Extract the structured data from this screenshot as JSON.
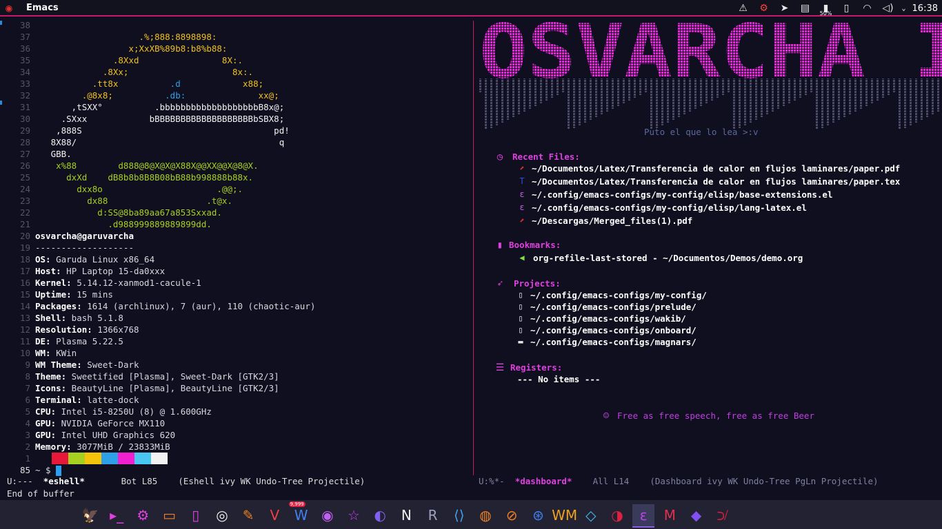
{
  "window": {
    "title": "Emacs"
  },
  "tray": {
    "icons": [
      "alert-icon",
      "network-monitor-icon",
      "send-icon",
      "clipboard-icon",
      "battery-icon",
      "phone-icon",
      "wifi-icon",
      "volume-icon"
    ],
    "battery_label": "50%",
    "clock": "16:38"
  },
  "eshell": {
    "art": [
      {
        "n": "38",
        "t": ""
      },
      {
        "n": "37",
        "segs": [
          [
            "y",
            "                    .%;888:8898898:"
          ]
        ]
      },
      {
        "n": "36",
        "segs": [
          [
            "y",
            "                  x;XxXB%89b8:b8%b88:"
          ]
        ]
      },
      {
        "n": "35",
        "segs": [
          [
            "y",
            "               .8Xxd                8X:."
          ]
        ]
      },
      {
        "n": "34",
        "segs": [
          [
            "y",
            "             .8Xx;                    8x:."
          ]
        ]
      },
      {
        "n": "33",
        "segs": [
          [
            "y",
            "           .tt8x          "
          ],
          [
            "b",
            ".d"
          ],
          [
            "y",
            "            x88;"
          ]
        ]
      },
      {
        "n": "32",
        "segs": [
          [
            "y",
            "         .@8x8;          "
          ],
          [
            "b",
            ".db:"
          ],
          [
            "y",
            "              xx@;"
          ]
        ]
      },
      {
        "n": "31",
        "segs": [
          [
            "w",
            "       ,tSXX°          .bbbbbbbbbbbbbbbbbbbB8x@;"
          ]
        ]
      },
      {
        "n": "30",
        "segs": [
          [
            "w",
            "     .SXxx            bBBBBBBBBBBBBBBBBBBBbSBX8;"
          ]
        ]
      },
      {
        "n": "29",
        "segs": [
          [
            "w",
            "    ,888S                                     pd!"
          ]
        ]
      },
      {
        "n": "28",
        "segs": [
          [
            "w",
            "   8X88/                                       q"
          ]
        ]
      },
      {
        "n": "27",
        "segs": [
          [
            "w",
            "   GBB."
          ]
        ]
      },
      {
        "n": "26",
        "segs": [
          [
            "g",
            "    x%88        d888@8@X@X@X88X@@XX@@X@8@X."
          ]
        ]
      },
      {
        "n": "25",
        "segs": [
          [
            "g",
            "      dxXd    dB8b8b8B8B08bB88b998888b88x."
          ]
        ]
      },
      {
        "n": "24",
        "segs": [
          [
            "g",
            "        dxx8o                      .@@;."
          ]
        ]
      },
      {
        "n": "23",
        "segs": [
          [
            "g",
            "          dx88                   .t@x."
          ]
        ]
      },
      {
        "n": "22",
        "segs": [
          [
            "g",
            "            d:SS@8ba89aa67a853Sxxad."
          ]
        ]
      },
      {
        "n": "21",
        "segs": [
          [
            "g",
            "              .d988999889889899dd."
          ]
        ]
      }
    ],
    "host_line": {
      "n": "20",
      "text": "osvarcha@garuvarcha"
    },
    "sep_line": {
      "n": "19",
      "text": "-------------------"
    },
    "info": [
      {
        "n": "18",
        "key": "OS",
        "val": " Garuda Linux x86_64"
      },
      {
        "n": "17",
        "key": "Host",
        "val": " HP Laptop 15-da0xxx"
      },
      {
        "n": "16",
        "key": "Kernel",
        "val": " 5.14.12-xanmod1-cacule-1"
      },
      {
        "n": "15",
        "key": "Uptime",
        "val": " 15 mins"
      },
      {
        "n": "14",
        "key": "Packages",
        "val": " 1614 (archlinux), 7 (aur), 110 (chaotic-aur)"
      },
      {
        "n": "13",
        "key": "Shell",
        "val": " bash 5.1.8"
      },
      {
        "n": "12",
        "key": "Resolution",
        "val": " 1366x768"
      },
      {
        "n": "11",
        "key": "DE",
        "val": " Plasma 5.22.5"
      },
      {
        "n": "10",
        "key": "WM",
        "val": " KWin"
      },
      {
        "n": "9",
        "key": "WM Theme",
        "val": " Sweet-Dark"
      },
      {
        "n": "8",
        "key": "Theme",
        "val": " Sweetified [Plasma], Sweet-Dark [GTK2/3]"
      },
      {
        "n": "7",
        "key": "Icons",
        "val": " BeautyLine [Plasma], BeautyLine [GTK2/3]"
      },
      {
        "n": "6",
        "key": "Terminal",
        "val": " latte-dock"
      },
      {
        "n": "5",
        "key": "CPU",
        "val": " Intel i5-8250U (8) @ 1.600GHz"
      },
      {
        "n": "4",
        "key": "GPU",
        "val": " NVIDIA GeForce MX110"
      },
      {
        "n": "3",
        "key": "GPU",
        "val": " Intel UHD Graphics 620"
      },
      {
        "n": "2",
        "key": "Memory",
        "val": " 3077MiB / 23833MiB"
      }
    ],
    "palette_line_num": "1",
    "palette": [
      "#e8183a",
      "#a8d020",
      "#f4c40c",
      "#2ea0e8",
      "#f020d0",
      "#48c8f0",
      "#f2f2f2"
    ],
    "prompt_line_num": "85",
    "prompt": "~ $ "
  },
  "dashboard": {
    "banner_text": "OSVARCHA I",
    "tagline": "Puto el que lo lea >:v",
    "recent_files_title": "Recent Files:",
    "recent_files": [
      {
        "icon": "pdf-icon",
        "color": "#e03030",
        "glyph": "⬈",
        "text": "~/Documentos/Latex/Transferencia de calor en flujos laminares/paper.pdf"
      },
      {
        "icon": "tex-icon",
        "color": "#3050e0",
        "glyph": "T",
        "text": "~/Documentos/Latex/Transferencia de calor en flujos laminares/paper.tex"
      },
      {
        "icon": "elisp-icon",
        "color": "#c060e0",
        "glyph": "ε",
        "text": "~/.config/emacs-configs/my-config/elisp/base-extensions.el"
      },
      {
        "icon": "elisp-icon",
        "color": "#c060e0",
        "glyph": "ε",
        "text": "~/.config/emacs-configs/my-config/elisp/lang-latex.el"
      },
      {
        "icon": "pdf-icon",
        "color": "#e03030",
        "glyph": "⬈",
        "text": "~/Descargas/Merged_files(1).pdf"
      }
    ],
    "bookmarks_title": "Bookmarks:",
    "bookmarks": [
      {
        "icon": "unicorn-icon",
        "color": "#80e040",
        "text": "org-refile-last-stored - ~/Documentos/Demos/demo.org"
      }
    ],
    "projects_title": "Projects:",
    "projects": [
      {
        "icon": "repo-icon",
        "glyph": "▯",
        "text": "~/.config/emacs-configs/my-config/"
      },
      {
        "icon": "repo-icon",
        "glyph": "▯",
        "text": "~/.config/emacs-configs/prelude/"
      },
      {
        "icon": "repo-icon",
        "glyph": "▯",
        "text": "~/.config/emacs-configs/wakib/"
      },
      {
        "icon": "repo-icon",
        "glyph": "▯",
        "text": "~/.config/emacs-configs/onboard/"
      },
      {
        "icon": "folder-icon",
        "glyph": "▬",
        "text": "~/.config/emacs-configs/magnars/"
      }
    ],
    "registers_title": "Registers:",
    "registers_empty": "--- No items ---",
    "footer": "Free as free speech, free as free Beer"
  },
  "modeline_left": {
    "state": "U:---  ",
    "buffer": "*eshell*",
    "pos": "       Bot L85    ",
    "modes": "(Eshell ivy WK Undo-Tree Projectile)"
  },
  "modeline_right": {
    "state": "U:%*-  ",
    "buffer": "*dashboard*",
    "pos": "    All L14    ",
    "modes": "(Dashboard ivy WK Undo-Tree PgLn Projectile)"
  },
  "minibuffer": "End of buffer",
  "dock": [
    {
      "name": "garuda-dock-icon",
      "glyph": "🦅",
      "color": "#e03030"
    },
    {
      "name": "terminal-dock-icon",
      "glyph": "▸_",
      "color": "#e040e0"
    },
    {
      "name": "settings-dock-icon",
      "glyph": "⚙",
      "color": "#e040e0"
    },
    {
      "name": "files-dock-icon",
      "glyph": "▭",
      "color": "#f08020"
    },
    {
      "name": "phone-dock-icon",
      "glyph": "▯",
      "color": "#e040e0"
    },
    {
      "name": "camera-dock-icon",
      "glyph": "◎",
      "color": "#f0f0f0"
    },
    {
      "name": "editor-dock-icon",
      "glyph": "✎",
      "color": "#f08020"
    },
    {
      "name": "vivaldi-dock-icon",
      "glyph": "V",
      "color": "#f04040"
    },
    {
      "name": "writer-dock-icon",
      "glyph": "W",
      "color": "#4080f0",
      "badge": "9,999"
    },
    {
      "name": "discord-dock-icon",
      "glyph": "◉",
      "color": "#c060f0"
    },
    {
      "name": "star-dock-icon",
      "glyph": "☆",
      "color": "#c040f0"
    },
    {
      "name": "firefox-dock-icon",
      "glyph": "◐",
      "color": "#8060f0"
    },
    {
      "name": "notion-dock-icon",
      "glyph": "N",
      "color": "#f0f0f0"
    },
    {
      "name": "r-dock-icon",
      "glyph": "R",
      "color": "#a0a0c0"
    },
    {
      "name": "vscode-dock-icon",
      "glyph": "⟨⟩",
      "color": "#40a0f0"
    },
    {
      "name": "blender-dock-icon",
      "glyph": "◍",
      "color": "#f08020"
    },
    {
      "name": "scope-dock-icon",
      "glyph": "⊘",
      "color": "#f08020"
    },
    {
      "name": "network-dock-icon",
      "glyph": "⊛",
      "color": "#4080f0"
    },
    {
      "name": "wm-dock-icon",
      "glyph": "WM",
      "color": "#f0a020"
    },
    {
      "name": "vpn-dock-icon",
      "glyph": "◇",
      "color": "#40c0f0"
    },
    {
      "name": "palette-dock-icon",
      "glyph": "◑",
      "color": "#e02040"
    },
    {
      "name": "emacs-dock-icon",
      "glyph": "ε",
      "color": "#c040f0",
      "active": true
    },
    {
      "name": "mega-dock-icon",
      "glyph": "M",
      "color": "#e03050"
    },
    {
      "name": "obsidian-dock-icon",
      "glyph": "◆",
      "color": "#8050f0"
    },
    {
      "name": "crop-dock-icon",
      "glyph": "⟉",
      "color": "#e02040"
    }
  ]
}
